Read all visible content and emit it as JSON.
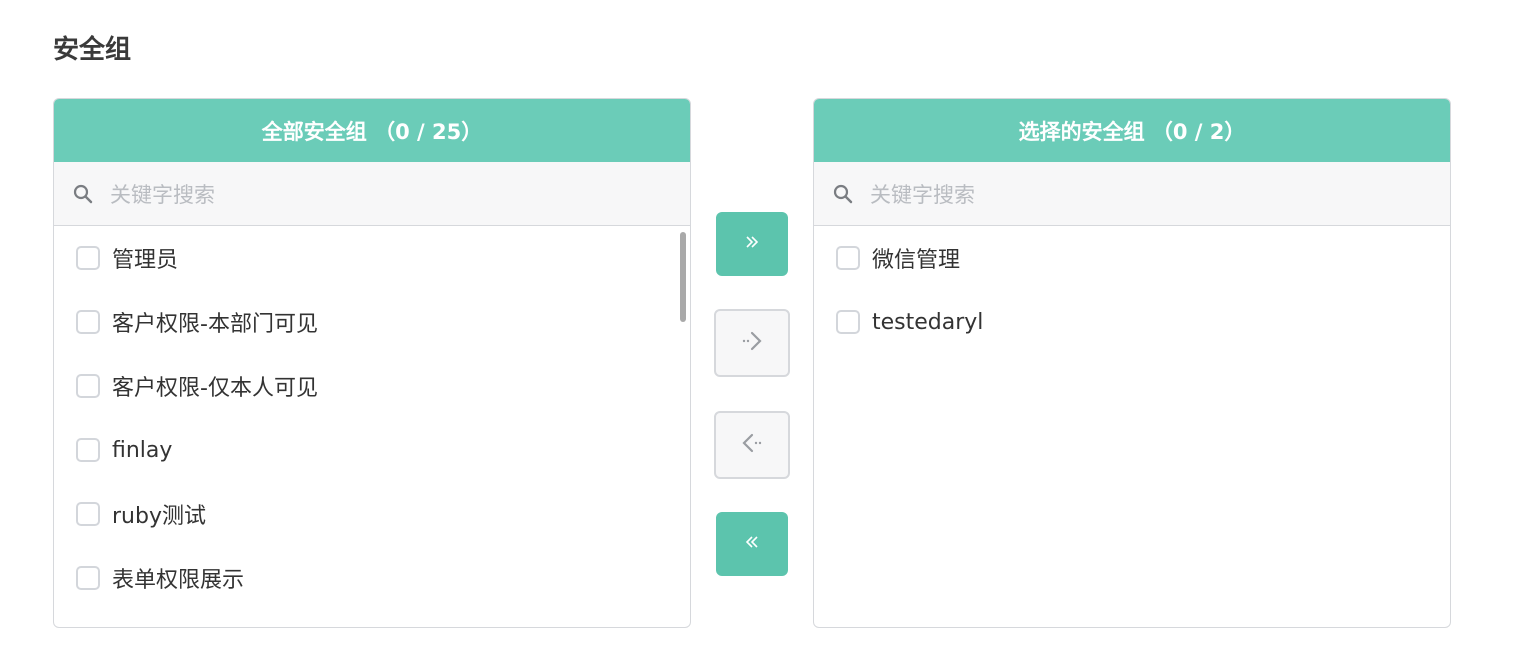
{
  "section": {
    "title": "安全组"
  },
  "left_panel": {
    "header": "全部安全组 （0 / 25）",
    "search_placeholder": "关键字搜索",
    "items": [
      {
        "label": "管理员"
      },
      {
        "label": "客户权限-本部门可见"
      },
      {
        "label": "客户权限-仅本人可见"
      },
      {
        "label": "finlay"
      },
      {
        "label": "ruby测试"
      },
      {
        "label": "表单权限展示"
      }
    ]
  },
  "right_panel": {
    "header": "选择的安全组 （0 / 2）",
    "search_placeholder": "关键字搜索",
    "items": [
      {
        "label": "微信管理"
      },
      {
        "label": "testedaryl"
      }
    ]
  },
  "buttons": {
    "move_all_right_icon": "double-chevron-right-icon",
    "move_right_icon": "dotted-chevron-right-icon",
    "move_left_icon": "dotted-chevron-left-icon",
    "move_all_left_icon": "double-chevron-left-icon"
  },
  "colors": {
    "accent": "#6bccb8",
    "button_active": "#5cc4ad",
    "border": "#d6d8dc"
  }
}
